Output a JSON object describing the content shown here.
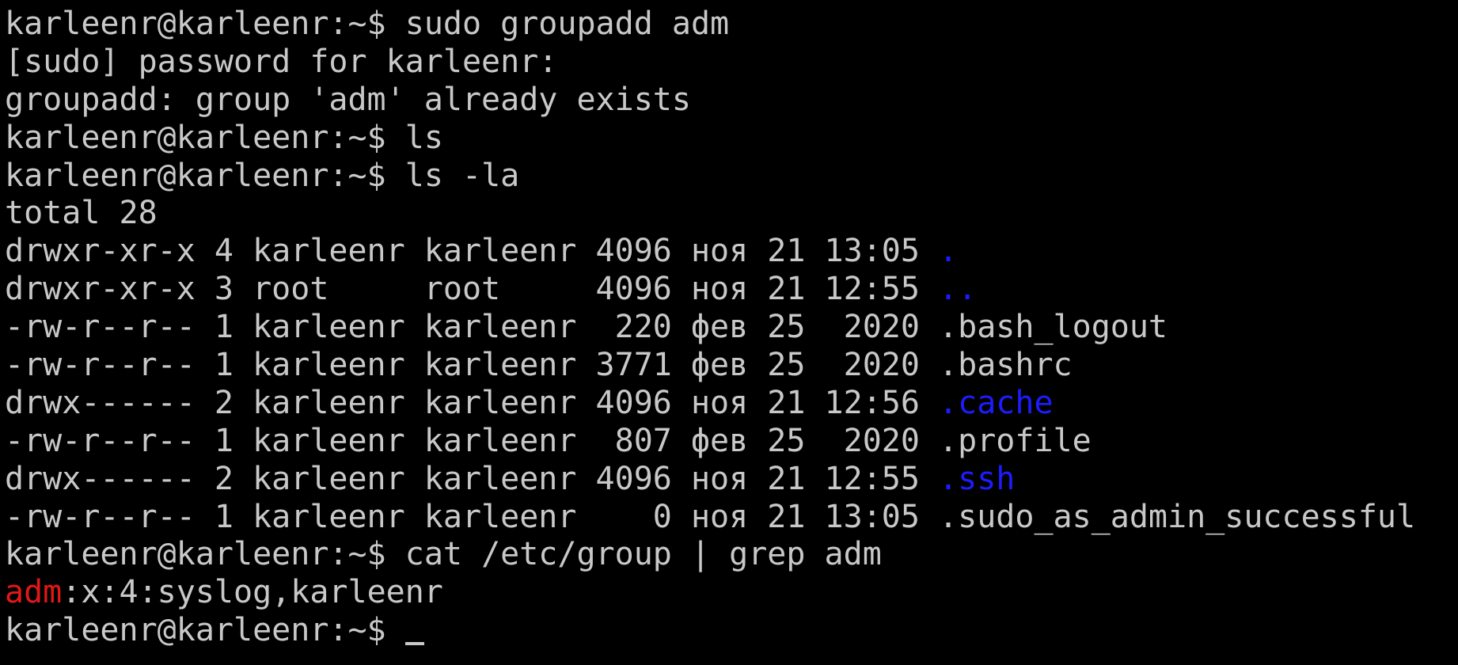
{
  "terminal": {
    "background": "#000000",
    "foreground": "#c8c8c8",
    "dir_color": "#1c1cff",
    "match_color": "#e01818",
    "prompt": "karleenr@karleenr:~$ ",
    "lines": [
      {
        "kind": "cmd",
        "cmd": "sudo groupadd adm"
      },
      {
        "kind": "out",
        "text": "[sudo] password for karleenr:"
      },
      {
        "kind": "out",
        "text": "groupadd: group 'adm' already exists"
      },
      {
        "kind": "cmd",
        "cmd": "ls"
      },
      {
        "kind": "cmd",
        "cmd": "ls -la"
      },
      {
        "kind": "out",
        "text": "total 28"
      },
      {
        "kind": "ls",
        "meta": "drwxr-xr-x 4 karleenr karleenr 4096 ноя 21 13:05 ",
        "name": ".",
        "is_dir": true
      },
      {
        "kind": "ls",
        "meta": "drwxr-xr-x 3 root     root     4096 ноя 21 12:55 ",
        "name": "..",
        "is_dir": true
      },
      {
        "kind": "ls",
        "meta": "-rw-r--r-- 1 karleenr karleenr  220 фев 25  2020 ",
        "name": ".bash_logout",
        "is_dir": false
      },
      {
        "kind": "ls",
        "meta": "-rw-r--r-- 1 karleenr karleenr 3771 фев 25  2020 ",
        "name": ".bashrc",
        "is_dir": false
      },
      {
        "kind": "ls",
        "meta": "drwx------ 2 karleenr karleenr 4096 ноя 21 12:56 ",
        "name": ".cache",
        "is_dir": true
      },
      {
        "kind": "ls",
        "meta": "-rw-r--r-- 1 karleenr karleenr  807 фев 25  2020 ",
        "name": ".profile",
        "is_dir": false
      },
      {
        "kind": "ls",
        "meta": "drwx------ 2 karleenr karleenr 4096 ноя 21 12:55 ",
        "name": ".ssh",
        "is_dir": true
      },
      {
        "kind": "ls",
        "meta": "-rw-r--r-- 1 karleenr karleenr    0 ноя 21 13:05 ",
        "name": ".sudo_as_admin_successful",
        "is_dir": false
      },
      {
        "kind": "cmd",
        "cmd": "cat /etc/group | grep adm"
      },
      {
        "kind": "grep",
        "match": "adm",
        "rest": ":x:4:syslog,karleenr"
      },
      {
        "kind": "cmd",
        "cmd": "",
        "cursor": true
      }
    ]
  }
}
